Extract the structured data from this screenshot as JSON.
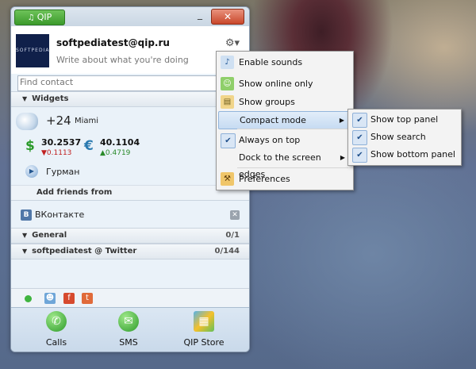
{
  "window": {
    "qip_button": "QIP",
    "close_symbol": "✕",
    "minimize_symbol": "_"
  },
  "profile": {
    "account": "softpediatest@qip.ru",
    "status_message": "Write about what you're doing",
    "avatar_text": "SOFTPEDIA"
  },
  "search": {
    "placeholder": "Find contact"
  },
  "widgets": {
    "header": "Widgets",
    "weather": {
      "temp": "+24",
      "city": "Miami"
    },
    "currencies": [
      {
        "icon": "$",
        "value": "30.2537",
        "change": "▼0.1113",
        "direction": "down"
      },
      {
        "icon": "€",
        "value": "40.1104",
        "change": "▲0.4719",
        "direction": "up"
      }
    ],
    "player": {
      "label": "Гурман"
    }
  },
  "add_friends": {
    "header": "Add friends from",
    "item": "ВКонтакте",
    "vk_icon": "В"
  },
  "groups": [
    {
      "name": "General",
      "count": "0/1"
    },
    {
      "name": "softpediatest @ Twitter",
      "count": "0/144"
    }
  ],
  "bottom_bar": {
    "buttons": [
      {
        "label": "Calls",
        "icon": "phone-icon"
      },
      {
        "label": "SMS",
        "icon": "sms-icon"
      },
      {
        "label": "QIP Store",
        "icon": "store-icon"
      }
    ]
  },
  "context_menu": {
    "items": [
      {
        "label": "Enable sounds",
        "icon": "music-note-icon"
      },
      {
        "label": "Show online only",
        "icon": "contacts-icon"
      },
      {
        "label": "Show groups",
        "icon": "groups-icon"
      },
      {
        "label": "Compact mode",
        "submenu": true,
        "highlighted": true
      },
      {
        "label": "Always on top",
        "checked": true
      },
      {
        "label": "Dock to the screen edges",
        "submenu": true
      },
      {
        "label": "Preferences",
        "icon": "preferences-icon"
      }
    ]
  },
  "submenu": {
    "items": [
      {
        "label": "Show top panel",
        "checked": true
      },
      {
        "label": "Show search",
        "checked": true
      },
      {
        "label": "Show bottom panel",
        "checked": true
      }
    ]
  },
  "colors": {
    "accent": "#3b9a2b",
    "close": "#c9472b",
    "price_down": "#c02020",
    "price_up": "#2a8a2a"
  }
}
